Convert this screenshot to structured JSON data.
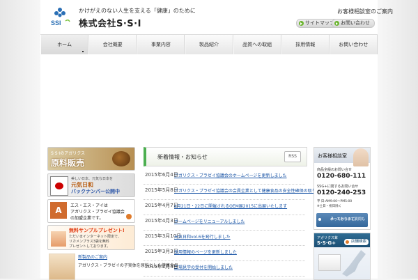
{
  "header": {
    "tagline": "かけがえのない人生を支える「健康」のために",
    "company_name": "株式会社S·S·I",
    "logo_text": "SSI",
    "top_link": "お客様相談室のご案内",
    "pill_sitemap": "サイトマップ",
    "pill_contact": "お問い合わせ"
  },
  "nav": {
    "items": [
      "ホーム",
      "会社概要",
      "事業内容",
      "製品紹介",
      "品質への取組",
      "採用情報",
      "お問い合わせ"
    ]
  },
  "left_banners": {
    "b1_small": "S·S·Iのアガリクス",
    "b1_big": "原料販売",
    "b2_small": "美しい日本、元気な日本を",
    "b2_big": "元気日和",
    "b2_big2": "バックナンバー公開中",
    "b3_logo": "A",
    "b3_line1": "エス・エス・アイは",
    "b3_line2": "アガリクス・ブラゼイ協議会",
    "b3_line3": "の加盟企業です。",
    "b4_title": "無料サンプルプレゼント!",
    "b4_line1": "ただいまインターネット限定で、",
    "b4_line2": "リカメンプラス3袋を無料",
    "b4_line3": "プレゼントしております。",
    "product_title": "新製品のご案内",
    "product_desc": "アガリクス・ブラゼイの子実体を原料とした健康食品"
  },
  "news": {
    "heading": "新着情報・お知らせ",
    "rss": "RSS",
    "items": [
      {
        "date": "2015年6月4日",
        "text": "アガリクス・ブラゼイ協議会のホームページを更新しました"
      },
      {
        "date": "2015年5月8日",
        "text": "アガリクス・ブラゼイ協議会の会員企業として健康食品の安全性確保の取り組みを行っています"
      },
      {
        "date": "2015年4月7日",
        "text": "4月21日・22日に開催されるOEM展2015に出展いたします"
      },
      {
        "date": "2015年4月3日",
        "text": "ホームページをリニューアルしました"
      },
      {
        "date": "2015年3月10日",
        "text": "元気日和vol.6を発行しました"
      },
      {
        "date": "2015年3月3日",
        "text": "採用情報のページを更新しました"
      },
      {
        "date": "2015年2月4日",
        "text": "工場見学の受付を開始しました"
      }
    ]
  },
  "contact": {
    "title": "お客様相談室",
    "line1": "商品全般のお問い合せ",
    "phone1": "0120-680-111",
    "line2": "SSG+に関するお問い合せ",
    "phone2": "0120-240-253",
    "hours": "平 日:AM9:00〜PM5:00",
    "closed": "※土日・祝日除く",
    "mail_line1": "メールからのご質問も",
    "mail_line2": "承っております。"
  },
  "store": {
    "small": "アガリクス茸",
    "title": "S·S·G+",
    "button": "店舗検索"
  },
  "colors": {
    "accent_green": "#4caf50",
    "link_blue": "#1a55a6",
    "store_blue": "#1b4e73"
  }
}
